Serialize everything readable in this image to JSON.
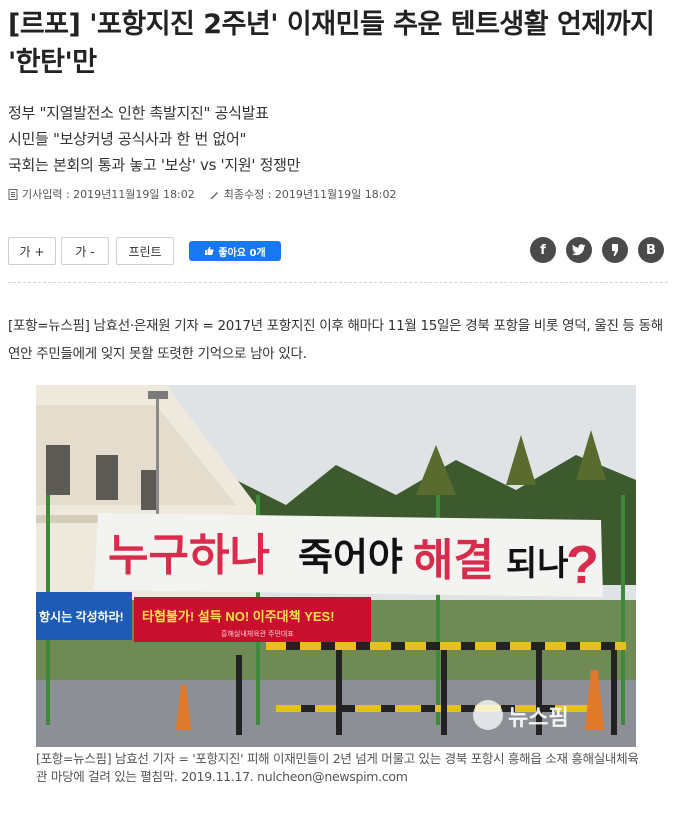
{
  "article": {
    "title": "[르포] '포항지진 2주년' 이재민들 추운 텐트생활 언제까지 '한탄'만",
    "subtitles": [
      "정부 \"지열발전소 인한 촉발지진\" 공식발표",
      "시민들 \"보상커녕 공식사과 한 번 없어\"",
      "국회는 본회의 통과 놓고 '보상' vs '지원' 정쟁만"
    ],
    "meta": {
      "input_label": "기사입력 : 2019년11월19일 18:02",
      "edit_label": "최종수정 : 2019년11월19일 18:02"
    },
    "lead": "[포항=뉴스핌] 남효선·은재원 기자 = 2017년 포항지진 이후 해마다 11월 15일은 경북 포항을 비롯 영덕, 울진 등 동해연안 주민들에게 잊지 못할 또렷한 기억으로 남아 있다.",
    "caption": "[포항=뉴스핌] 남효선 기자 = '포항지진' 피해 이재민들이 2년 넘게 머물고 있는 경북 포항시 흥해읍 소재 흥해실내체육관 마당에 걸려 있는 펼침막. 2019.11.17. nulcheon@newspim.com"
  },
  "toolbar": {
    "font_up": "가 +",
    "font_down": "가 -",
    "print": "프린트",
    "like": "좋아요 0개"
  },
  "share": {
    "facebook_icon": "f",
    "twitter_icon": "twitter-bird-icon",
    "kakao_icon": "kakao-story-icon",
    "blog_icon": "B"
  },
  "photo": {
    "banner_red1": "누구하나",
    "banner_black1": "죽어야",
    "banner_red2": "해결",
    "banner_black2": "되나",
    "banner_q": "?",
    "blue_sign": "항시는 각성하라!",
    "red_sign": "타협불가! 설득 NO! 이주대책 YES!",
    "red_sign_small": "흥해실내체육관 주민대표",
    "watermark": "뉴스핌"
  },
  "colors": {
    "accent_red": "#d92b4b",
    "facebook": "#1877f2",
    "icon_dark": "#4a4a4a"
  }
}
